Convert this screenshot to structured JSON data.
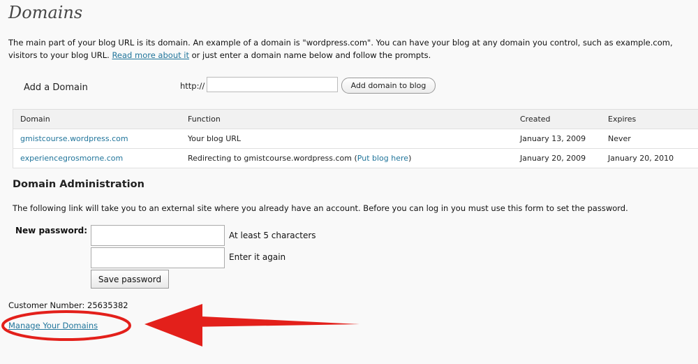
{
  "page": {
    "title": "Domains",
    "intro_line1_text": "The main part of your blog URL is its domain. An example of a domain is \"wordpress.com\". You can have your blog at any domain you control, such as example.com,",
    "intro_line2_prefix": "visitors to your blog URL. ",
    "intro_link": "Read more about it",
    "intro_line2_suffix": " or just enter a domain name below and follow the prompts."
  },
  "add_domain": {
    "label": "Add a Domain",
    "prefix": "http://",
    "input_value": "",
    "button_label": "Add domain to blog"
  },
  "domains_table": {
    "headers": [
      "Domain",
      "Function",
      "Created",
      "Expires"
    ],
    "rows": [
      {
        "domain": "gmistcourse.wordpress.com",
        "function": "Your blog URL",
        "function_link": "",
        "function_suffix": "",
        "created": "January 13, 2009",
        "expires": "Never"
      },
      {
        "domain": "experiencegrosmorne.com",
        "function": "Redirecting to gmistcourse.wordpress.com (",
        "function_link": "Put blog here",
        "function_suffix": ")",
        "created": "January 20, 2009",
        "expires": "January 20, 2010"
      }
    ]
  },
  "admin": {
    "title": "Domain Administration",
    "description": "The following link will take you to an external site where you already have an account. Before you can log in you must use this form to set the password.",
    "new_password_label": "New password:",
    "hint_1": "At least 5 characters",
    "hint_2": "Enter it again",
    "save_button": "Save password",
    "customer_number": "Customer Number: 25635382",
    "manage_link": "Manage Your Domains"
  },
  "annotation": {
    "color": "#e3201b",
    "icon": "arrow-left-icon"
  }
}
